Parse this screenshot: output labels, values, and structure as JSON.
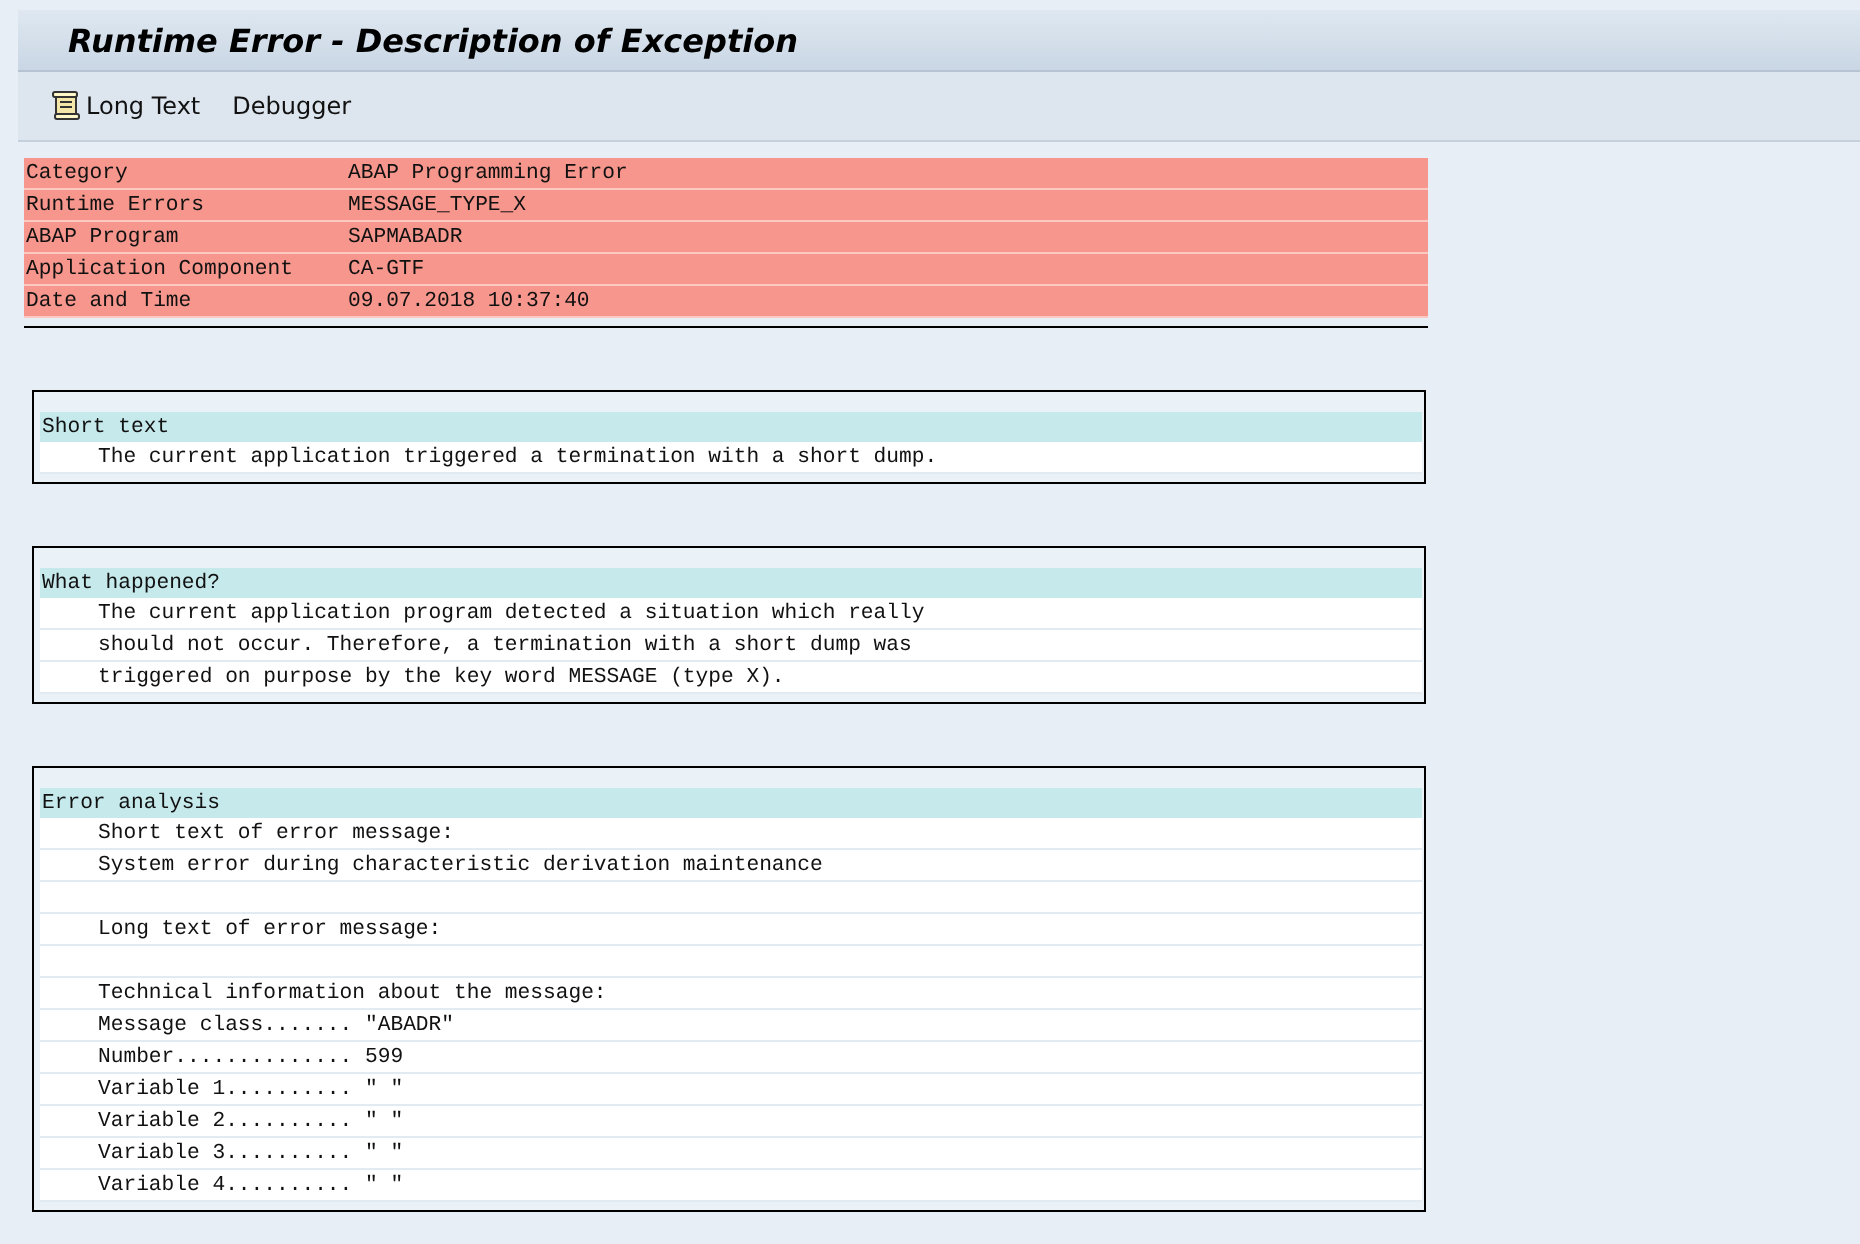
{
  "window": {
    "title": "Runtime Error - Description of Exception"
  },
  "toolbar": [
    {
      "label": "Long Text",
      "icon": true
    },
    {
      "label": "Debugger",
      "icon": false
    }
  ],
  "header_fields": [
    {
      "label": "Category",
      "value": "ABAP Programming Error"
    },
    {
      "label": "Runtime Errors",
      "value": "MESSAGE_TYPE_X"
    },
    {
      "label": "ABAP Program",
      "value": "SAPMABADR"
    },
    {
      "label": "Application Component",
      "value": "CA-GTF"
    },
    {
      "label": "Date and Time",
      "value": "09.07.2018 10:37:40"
    }
  ],
  "sections": [
    {
      "title": "Short text",
      "lines": [
        {
          "kind": "text",
          "text": "The current application triggered a termination with a short dump."
        }
      ]
    },
    {
      "title": "What happened?",
      "lines": [
        {
          "kind": "text",
          "text": "The current application program detected a situation which really"
        },
        {
          "kind": "text",
          "text": "should not occur. Therefore, a termination with a short dump was"
        },
        {
          "kind": "text",
          "text": "triggered on purpose by the key word MESSAGE (type X)."
        }
      ]
    },
    {
      "title": "Error analysis",
      "lines": [
        {
          "kind": "text",
          "text": "Short text of error message:"
        },
        {
          "kind": "text",
          "text": "System error during characteristic derivation maintenance"
        },
        {
          "kind": "blank"
        },
        {
          "kind": "text",
          "text": "Long text of error message:"
        },
        {
          "kind": "blank"
        },
        {
          "kind": "text",
          "text": "Technical information about the message:"
        },
        {
          "kind": "text",
          "text": "Message class....... \"ABADR\""
        },
        {
          "kind": "text",
          "text": "Number.............. 599"
        },
        {
          "kind": "text",
          "text": "Variable 1.......... \" \""
        },
        {
          "kind": "text",
          "text": "Variable 2.......... \" \""
        },
        {
          "kind": "text",
          "text": "Variable 3.......... \" \""
        },
        {
          "kind": "text",
          "text": "Variable 4.......... \" \""
        }
      ]
    }
  ]
}
